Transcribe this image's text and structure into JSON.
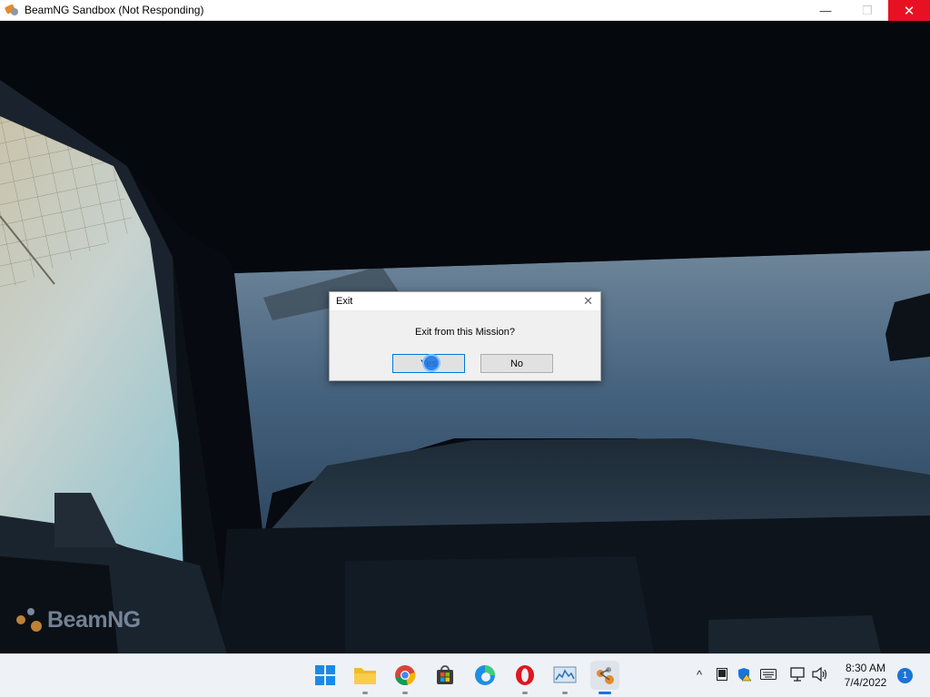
{
  "window": {
    "title": "BeamNG Sandbox (Not Responding)",
    "minimize_glyph": "—",
    "maximize_glyph": "❐",
    "close_glyph": "✕"
  },
  "game": {
    "watermark": "BeamNG"
  },
  "dialog": {
    "title": "Exit",
    "close_glyph": "✕",
    "message": "Exit from this Mission?",
    "yes_label": "Yes",
    "no_label": "No"
  },
  "taskbar": {
    "apps": [
      {
        "name": "start",
        "icon": "windows-start-icon"
      },
      {
        "name": "file-explorer",
        "icon": "folder-icon"
      },
      {
        "name": "chrome",
        "icon": "chrome-icon"
      },
      {
        "name": "store",
        "icon": "store-icon"
      },
      {
        "name": "edge",
        "icon": "edge-icon"
      },
      {
        "name": "opera",
        "icon": "opera-icon"
      },
      {
        "name": "resource-monitor",
        "icon": "monitor-chart-icon"
      },
      {
        "name": "beamng",
        "icon": "beamng-icon",
        "active": true
      }
    ],
    "tray": {
      "chevron": "^",
      "time": "8:30 AM",
      "date": "7/4/2022",
      "notification_count": "1"
    }
  },
  "colors": {
    "close_red": "#e81123",
    "accent_blue": "#1a73d9",
    "taskbar_bg": "#eef1f6",
    "dialog_bg": "#f0f0f0"
  }
}
